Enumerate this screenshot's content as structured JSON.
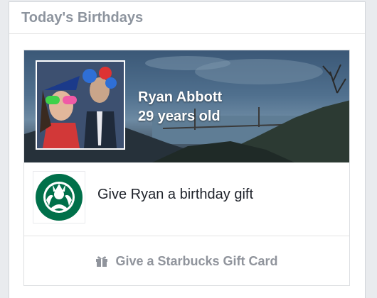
{
  "panel": {
    "title": "Today's Birthdays"
  },
  "birthday": {
    "name": "Ryan Abbott",
    "age_text": "29 years old"
  },
  "gift": {
    "prompt": "Give Ryan a birthday gift",
    "brand_icon": "starbucks-logo",
    "cta_label": "Give a Starbucks Gift Card",
    "cta_icon": "gift-icon"
  },
  "colors": {
    "panel_title": "#8d949e",
    "starbucks_green": "#00704a",
    "cta_text": "#90949c"
  }
}
